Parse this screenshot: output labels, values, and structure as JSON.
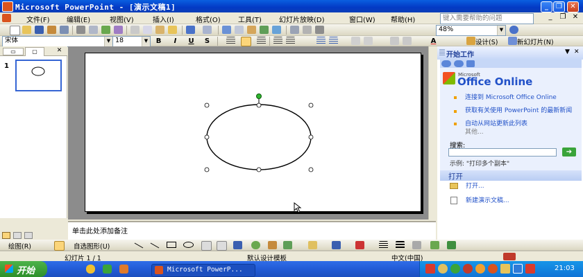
{
  "window": {
    "title": "Microsoft PowerPoint - [演示文稿1]"
  },
  "menu": {
    "items": [
      "文件(F)",
      "编辑(E)",
      "视图(V)",
      "插入(I)",
      "格式(O)",
      "工具(T)",
      "幻灯片放映(D)",
      "窗口(W)",
      "帮助(H)"
    ],
    "help_placeholder": "键入需要帮助的问题"
  },
  "standard_toolbar": {
    "zoom": "48%"
  },
  "formatting_toolbar": {
    "font": "宋体",
    "size": "18",
    "bold": "B",
    "italic": "I",
    "underline": "U",
    "shadow": "S",
    "font_color_label": "A",
    "design_label": "设计(S)",
    "new_slide_label": "新幻灯片(N)"
  },
  "outline": {
    "slide_number": "1"
  },
  "notes": {
    "placeholder": "单击此处添加备注"
  },
  "task_pane": {
    "title": "开始工作",
    "office_online_small": "Microsoft",
    "office_online_big": "Office Online",
    "links": [
      "连接到 Microsoft Office Online",
      "获取有关使用 PowerPoint 的最新新闻",
      "自动从网站更新此列表"
    ],
    "more": "其他...",
    "search_label": "搜索:",
    "search_example": "示例: \"打印多个副本\"",
    "open_header": "打开",
    "open_link": "打开...",
    "new_link": "新建演示文稿..."
  },
  "drawing_toolbar": {
    "draw_label": "绘图(R)",
    "autoshapes_label": "自选图形(U)"
  },
  "status_bar": {
    "slide": "幻灯片 1 / 1",
    "design": "默认设计模板",
    "language": "中文(中国)"
  },
  "taskbar": {
    "start_label": "开始",
    "task_label": "Microsoft PowerP...",
    "clock": "21:03"
  }
}
